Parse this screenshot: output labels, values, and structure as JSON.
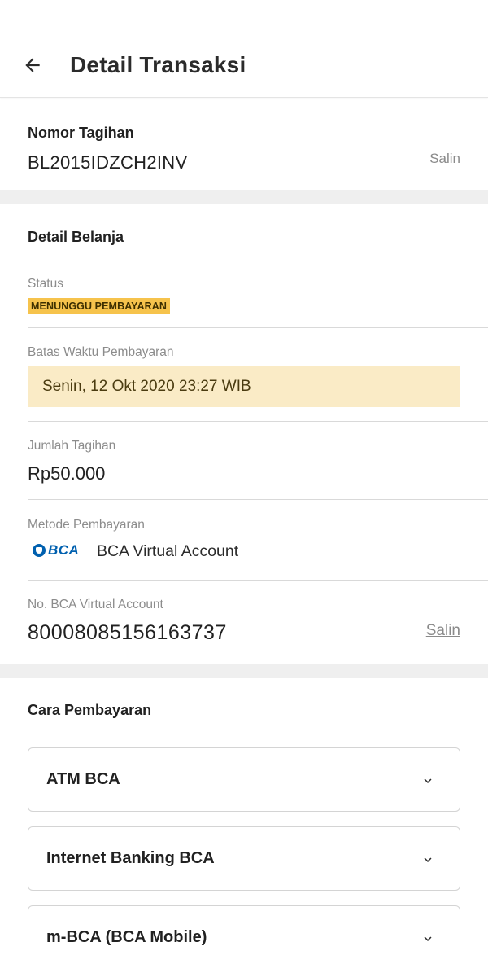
{
  "header": {
    "title": "Detail Transaksi",
    "back_icon": "arrow-left-icon"
  },
  "invoice": {
    "label": "Nomor Tagihan",
    "number": "BL2015IDZCH2INV",
    "copy_label": "Salin"
  },
  "detail": {
    "title": "Detail Belanja",
    "status_label": "Status",
    "status_value": "MENUNGGU PEMBAYARAN",
    "deadline_label": "Batas Waktu Pembayaran",
    "deadline_value": "Senin, 12 Okt 2020 23:27 WIB",
    "amount_label": "Jumlah Tagihan",
    "amount_value": "Rp50.000",
    "method_label": "Metode Pembayaran",
    "method_logo_text": "BCA",
    "method_value": "BCA Virtual Account",
    "va_label": "No. BCA Virtual Account",
    "va_number": "80008085156163737",
    "va_copy_label": "Salin"
  },
  "payment_guide": {
    "title": "Cara Pembayaran",
    "options": [
      {
        "label": "ATM BCA"
      },
      {
        "label": "Internet Banking BCA"
      },
      {
        "label": "m-BCA (BCA Mobile)"
      }
    ]
  },
  "colors": {
    "status_badge": "#f6c34c",
    "deadline_bg": "#faebc6",
    "section_divider": "#efefef",
    "bca_blue": "#0060af"
  }
}
